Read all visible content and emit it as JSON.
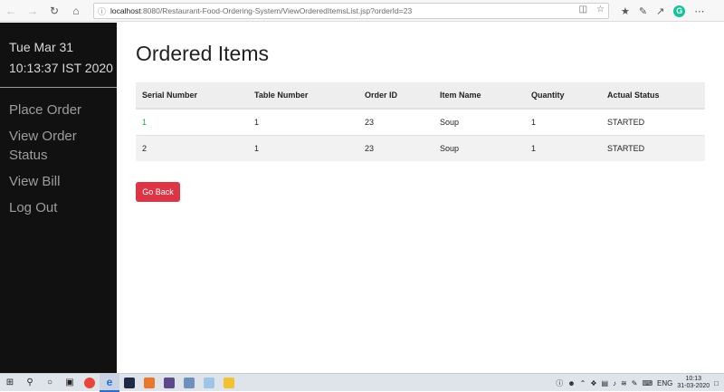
{
  "browser": {
    "url_host": "localhost",
    "url_path": ":8080/Restaurant-Food-Ordering-System/ViewOrderedItemsList.jsp?orderId=23",
    "icons": [
      "back-icon",
      "forward-icon",
      "refresh-icon",
      "home-icon",
      "info-icon",
      "reading-view-icon",
      "favorite-star-icon",
      "favorites-hub-icon",
      "notes-icon",
      "share-icon",
      "grammarly-icon",
      "more-icon"
    ]
  },
  "sidebar": {
    "date": "Tue Mar 31",
    "time": "10:13:37 IST 2020",
    "links": [
      "Place Order",
      "View Order Status",
      "View Bill",
      "Log Out"
    ]
  },
  "main": {
    "title": "Ordered Items",
    "columns": [
      "Serial Number",
      "Table Number",
      "Order ID",
      "Item Name",
      "Quantity",
      "Actual Status"
    ],
    "rows": [
      [
        "1",
        "1",
        "23",
        "Soup",
        "1",
        "STARTED"
      ],
      [
        "2",
        "1",
        "23",
        "Soup",
        "1",
        "STARTED"
      ]
    ],
    "go_back_label": "Go Back"
  },
  "colors": {
    "sidebar_bg": "#111111",
    "sidebar_link": "#9d9d9d",
    "button_danger": "#dc3545",
    "serial_link": "#28a745"
  },
  "taskbar": {
    "lang": "ENG",
    "clock_time": "10:13",
    "clock_date": "31-03-2020"
  }
}
